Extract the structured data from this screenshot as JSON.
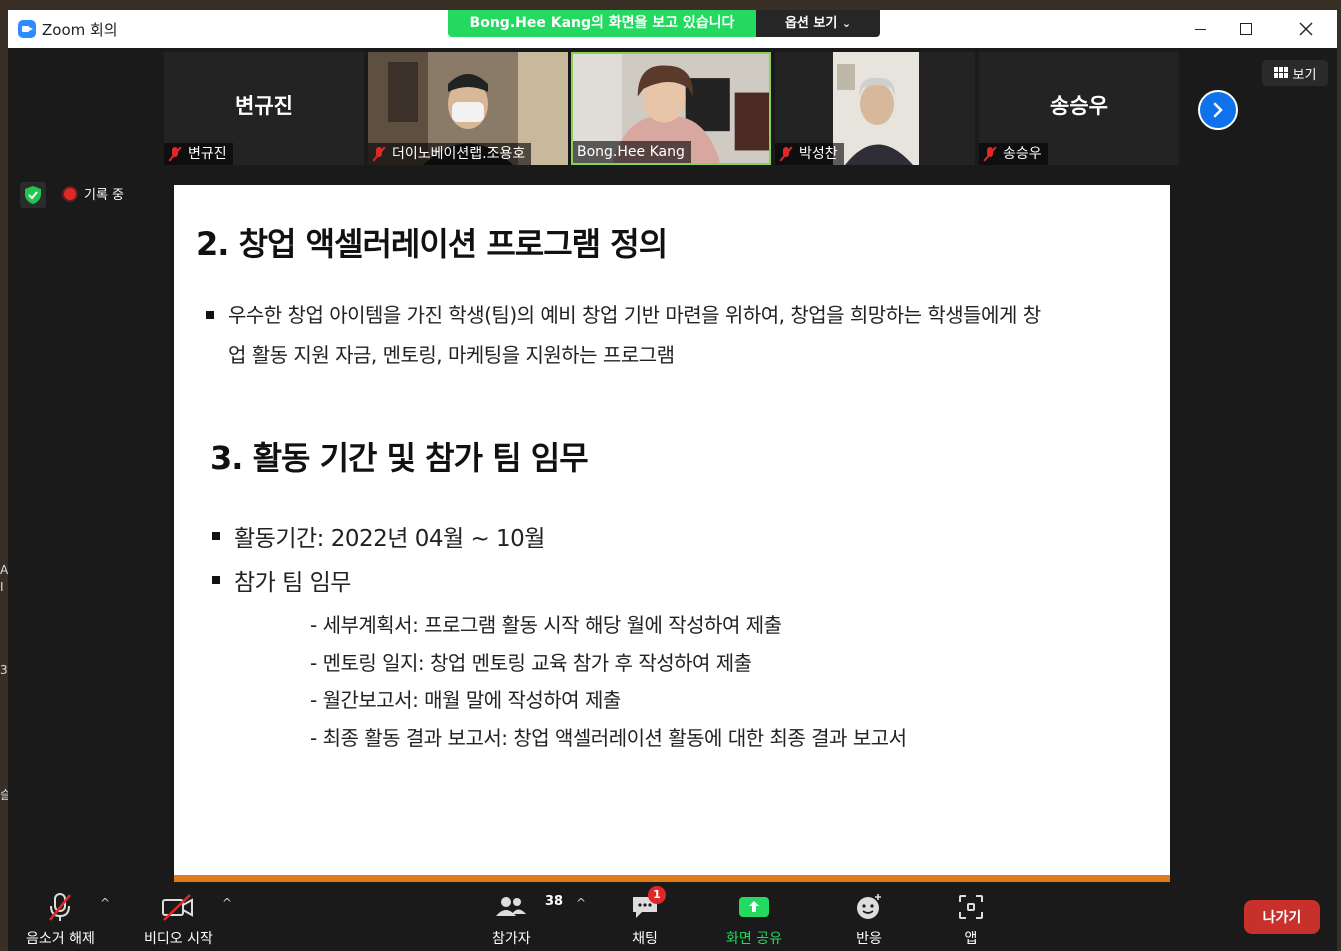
{
  "window": {
    "title": "Zoom 회의"
  },
  "share_banner": {
    "viewing_text": "Bong.Hee  Kang의 화면을 보고 있습니다",
    "options_label": "옵션 보기"
  },
  "participants_strip": {
    "view_label": "보기",
    "tiles": [
      {
        "big_name": "변규진",
        "label": "변규진",
        "muted": true,
        "video": false
      },
      {
        "big_name": "",
        "label": "더이노베이션랩.조용호",
        "muted": true,
        "video": true
      },
      {
        "big_name": "",
        "label": "Bong.Hee Kang",
        "muted": false,
        "video": true,
        "active": true
      },
      {
        "big_name": "",
        "label": "박성찬",
        "muted": true,
        "video": true
      },
      {
        "big_name": "송승우",
        "label": "송승우",
        "muted": true,
        "video": false
      }
    ]
  },
  "recording": {
    "label": "기록 중"
  },
  "slide": {
    "section2_title": "2. 창업 액셀러레이션 프로그램 정의",
    "section2_line1": "우수한 창업 아이템을 가진 학생(팀)의 예비 창업 기반 마련을 위하여, 창업을 희망하는 학생들에게 창",
    "section2_line2": "업 활동 지원 자금, 멘토링, 마케팅을 지원하는 프로그램",
    "section3_title": "3. 활동 기간 및 참가 팀 임무",
    "bullet_period": "활동기간: 2022년 04월 ~ 10월",
    "bullet_duties": "참가 팀 임무",
    "duties": [
      "- 세부계획서:  프로그램 활동 시작 해당 월에 작성하여 제출",
      "- 멘토링 일지: 창업 멘토링 교육 참가 후 작성하여 제출",
      "- 월간보고서: 매월 말에 작성하여 제출",
      "- 최종 활동 결과 보고서: 창업 액셀러레이션 활동에 대한 최종 결과 보고서"
    ]
  },
  "toolbar": {
    "unmute_label": "음소거 해제",
    "video_label": "비디오 시작",
    "participants_label": "참가자",
    "participants_count": "38",
    "chat_label": "채팅",
    "chat_badge": "1",
    "share_label": "화면 공유",
    "reactions_label": "반응",
    "apps_label": "앱",
    "leave_label": "나가기"
  },
  "edge_texts": [
    "A",
    "I",
    "3",
    "슬"
  ],
  "colors": {
    "share_green": "#23d960",
    "accent_blue": "#0e72ed",
    "leave_red": "#c7302b",
    "slide_orange": "#e07a1a"
  }
}
